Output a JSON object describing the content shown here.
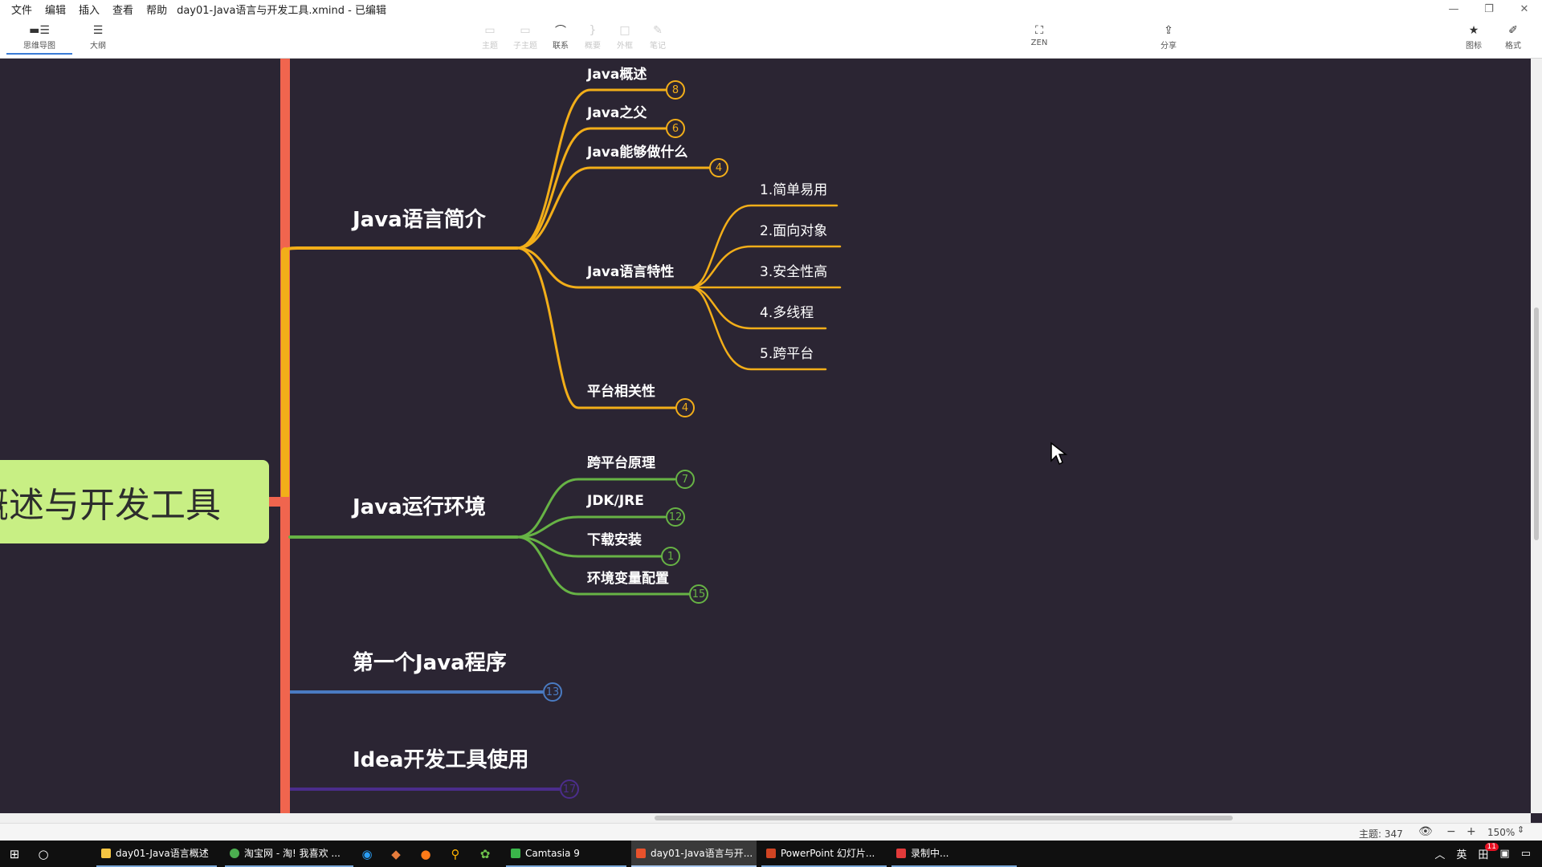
{
  "menubar": {
    "items": [
      "文件",
      "编辑",
      "插入",
      "查看",
      "帮助"
    ],
    "title": "day01-Java语言与开发工具.xmind - 已编辑"
  },
  "window_controls": [
    "—",
    "❐",
    "✕"
  ],
  "toolbar": {
    "mindmap": "思维导图",
    "outline": "大纲",
    "topic": "主题",
    "subtopic": "子主题",
    "relationship": "联系",
    "summary": "概要",
    "boundary": "外框",
    "notes": "笔记",
    "zen": "ZEN",
    "share": "分享",
    "icons": "图标",
    "format": "格式"
  },
  "mindmap": {
    "central": "概述与开发工具",
    "branches": [
      {
        "label": "Java语言简介",
        "color": "#f2ae19",
        "children": [
          {
            "label": "Java概述",
            "count": "8"
          },
          {
            "label": "Java之父",
            "count": "6"
          },
          {
            "label": "Java能够做什么",
            "count": "4"
          },
          {
            "label": "Java语言特性",
            "children": [
              "1.简单易用",
              "2.面向对象",
              "3.安全性高",
              "4.多线程",
              "5.跨平台"
            ]
          },
          {
            "label": "平台相关性",
            "count": "4"
          }
        ]
      },
      {
        "label": "Java运行环境",
        "color": "#67b345",
        "children": [
          {
            "label": "跨平台原理",
            "count": "7"
          },
          {
            "label": "JDK/JRE",
            "count": "12"
          },
          {
            "label": "下载安装",
            "count": "1"
          },
          {
            "label": "环境变量配置",
            "count": "15"
          }
        ]
      },
      {
        "label": "第一个Java程序",
        "color": "#4a7bc2",
        "count": "13"
      },
      {
        "label": "Idea开发工具使用",
        "color": "#4b2d8c",
        "count": "17"
      }
    ],
    "spine_color": "#f0654e",
    "central_color": "#c8ef84"
  },
  "statusbar": {
    "topics": "主题: 347",
    "zoom": "150%"
  },
  "taskbar": {
    "apps": [
      {
        "label": "day01-Java语言概述",
        "color": "#f5c542"
      },
      {
        "label": "淘宝网 - 淘! 我喜欢 ...",
        "color": "#4caf50"
      },
      {
        "label": "Camtasia 9",
        "color": "#3ab54a"
      },
      {
        "label": "day01-Java语言与开...",
        "color": "#e8522c"
      },
      {
        "label": "PowerPoint 幻灯片...",
        "color": "#d04423"
      },
      {
        "label": "录制中...",
        "color": "#e23a3a"
      }
    ],
    "tray": {
      "lang": "英",
      "ime": "田",
      "notifications": "11"
    }
  }
}
